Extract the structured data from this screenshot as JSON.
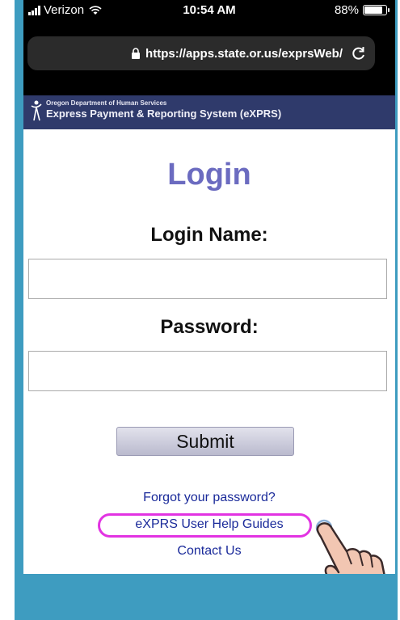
{
  "status_bar": {
    "carrier": "Verizon",
    "time": "10:54 AM",
    "battery": "88%",
    "battery_level": 0.88
  },
  "browser": {
    "url": "https://apps.state.or.us/exprsWeb/",
    "icons": [
      "lock-icon",
      "reload-icon"
    ]
  },
  "banner": {
    "org": "Oregon Department of Human Services",
    "system": "Express Payment & Reporting System (eXPRS)"
  },
  "login": {
    "title": "Login",
    "login_name_label": "Login Name:",
    "login_name_value": "",
    "password_label": "Password:",
    "password_value": "",
    "submit_label": "Submit"
  },
  "links": {
    "forgot_password": "Forgot your password?",
    "help_guides": "eXPRS User Help Guides",
    "contact_us": "Contact Us"
  },
  "colors": {
    "frame": "#3e9cc0",
    "banner": "#2f3a6b",
    "title": "#6b6bc0",
    "link": "#1a2a9a",
    "highlight": "#e233e2"
  }
}
